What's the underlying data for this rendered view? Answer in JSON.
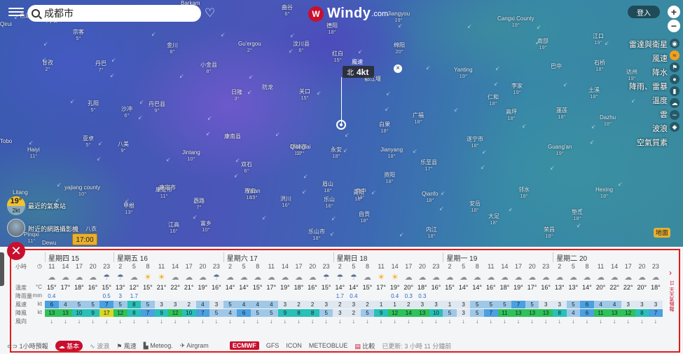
{
  "search": {
    "value": "成都市"
  },
  "logo": {
    "name": "Windy",
    "suffix": ".com"
  },
  "login_label": "登入",
  "zoom": {
    "in": "+",
    "out": "−"
  },
  "layers": [
    "雷達與衛星",
    "風速",
    "降水",
    "降雨、雷暴",
    "溫度",
    "雲",
    "波浪",
    "空氣質素"
  ],
  "active_layer": "風速",
  "wind_marker": {
    "caption": "風速",
    "direction": "北",
    "speed": "4kt"
  },
  "map_places": [
    {
      "n": "Barkam",
      "t": ""
    },
    {
      "n": "色达",
      "t": ""
    },
    {
      "n": "曲谷",
      "t": "6°"
    },
    {
      "n": "阿坝",
      "t": ""
    },
    {
      "n": "Jiangyou",
      "t": "19°"
    },
    {
      "n": "Cangxi County",
      "t": "19°"
    },
    {
      "n": "宗客",
      "t": "5°"
    },
    {
      "n": "金川",
      "t": "8°"
    },
    {
      "n": "Gu'ergou",
      "t": "2°"
    },
    {
      "n": "汶川县",
      "t": "6°"
    },
    {
      "n": "德阳",
      "t": "18°"
    },
    {
      "n": "绵阳",
      "t": "20°"
    },
    {
      "n": "南部",
      "t": "19°"
    },
    {
      "n": "江口",
      "t": "19°"
    },
    {
      "n": "达州",
      "t": "19°"
    },
    {
      "n": "甘孜",
      "t": "2°"
    },
    {
      "n": "丹巴",
      "t": "7°"
    },
    {
      "n": "小金县",
      "t": "8°"
    },
    {
      "n": "日隆",
      "t": "3°"
    },
    {
      "n": "防龙",
      "t": ""
    },
    {
      "n": "关口",
      "t": "15°"
    },
    {
      "n": "红白",
      "t": "15°"
    },
    {
      "n": "都江堰",
      "t": ""
    },
    {
      "n": "Yanting",
      "t": "19°"
    },
    {
      "n": "仁和",
      "t": "18°"
    },
    {
      "n": "李家",
      "t": "19°"
    },
    {
      "n": "土溪",
      "t": "18°"
    },
    {
      "n": "巴中",
      "t": ""
    },
    {
      "n": "石桥",
      "t": "18°"
    },
    {
      "n": "孔阳",
      "t": "5°"
    },
    {
      "n": "沙冲",
      "t": "6°"
    },
    {
      "n": "丹巴县",
      "t": "9°"
    },
    {
      "n": "康定市",
      "t": "11°"
    },
    {
      "n": "雅安",
      "t": "16°"
    },
    {
      "n": "邛崃市",
      "t": "18°"
    },
    {
      "n": "白果",
      "t": "18°"
    },
    {
      "n": "广福",
      "t": "18°"
    },
    {
      "n": "高坪",
      "t": "18°"
    },
    {
      "n": "蓬莲",
      "t": "18°"
    },
    {
      "n": "Dazhu",
      "t": "18°"
    },
    {
      "n": "八美",
      "t": "9°"
    },
    {
      "n": "亚卓",
      "t": "5°"
    },
    {
      "n": "Jintang",
      "t": "10°"
    },
    {
      "n": "Qionglai",
      "t": "17°"
    },
    {
      "n": "永安",
      "t": "18°"
    },
    {
      "n": "Jianyang",
      "t": "18°"
    },
    {
      "n": "乐至县",
      "t": "17°"
    },
    {
      "n": "遂宁市",
      "t": "18°"
    },
    {
      "n": "Guang'an",
      "t": "19°"
    },
    {
      "n": "Haiyi",
      "t": "11°"
    },
    {
      "n": "双石",
      "t": "6°"
    },
    {
      "n": "眉山",
      "t": "18°"
    },
    {
      "n": "资阳",
      "t": "18°"
    },
    {
      "n": "康南县",
      "t": ""
    },
    {
      "n": "yajiang county",
      "t": "10°"
    },
    {
      "n": "康定市",
      "t": ""
    },
    {
      "n": "Ya'an",
      "t": "13°"
    },
    {
      "n": "洪川",
      "t": "16°"
    },
    {
      "n": "资中",
      "t": "18°"
    },
    {
      "n": "Qianfo",
      "t": "18°"
    },
    {
      "n": "邻水",
      "t": "18°"
    },
    {
      "n": "Hexing",
      "t": "18°"
    },
    {
      "n": "甲根",
      "t": "13°"
    },
    {
      "n": "西路",
      "t": "7°"
    },
    {
      "n": "乐山",
      "t": "16°"
    },
    {
      "n": "青阳",
      "t": "18°"
    },
    {
      "n": "安岳",
      "t": "18°"
    },
    {
      "n": "内江",
      "t": "18°"
    },
    {
      "n": "荣昌",
      "t": "18°"
    },
    {
      "n": "富乡",
      "t": "10°"
    },
    {
      "n": "江高",
      "t": "16°"
    },
    {
      "n": "八衣",
      "t": "13°"
    },
    {
      "n": "乐山市",
      "t": "18°"
    },
    {
      "n": "自贡",
      "t": "18°"
    },
    {
      "n": "垫江",
      "t": "18°"
    },
    {
      "n": "大足",
      "t": "18°"
    },
    {
      "n": "Litang",
      "t": ""
    },
    {
      "n": "Dewu",
      "t": ""
    },
    {
      "n": "Qirui",
      "t": ""
    },
    {
      "n": "Pinqxi",
      "t": "11°"
    },
    {
      "n": "Tobo",
      "t": ""
    }
  ],
  "station": {
    "temp": "19°",
    "wind": "2kt",
    "label": "最近的氣象站"
  },
  "webcam": {
    "label": "附近的網路攝影機"
  },
  "time_pill": "17:00",
  "place_button": "地面",
  "forecast": {
    "days": [
      "星期四 15",
      "星期五 16",
      "星期六 17",
      "星期日 18",
      "星期一 19",
      "星期二 20"
    ],
    "row_labels": {
      "hours": "小時",
      "temp": "溫度",
      "temp_unit": "°C",
      "rain": "降雨量",
      "rain_unit": "mm",
      "wind": "風速",
      "wind_unit": "kt",
      "gust": "陣風",
      "gust_unit": "kt",
      "dir": "風向"
    },
    "hours": [
      "11",
      "14",
      "17",
      "20",
      "23",
      "2",
      "5",
      "8",
      "11",
      "14",
      "17",
      "20",
      "23",
      "2",
      "5",
      "8",
      "11",
      "14",
      "17",
      "20",
      "23",
      "2",
      "5",
      "8",
      "11",
      "14",
      "17",
      "20",
      "23",
      "2",
      "5",
      "8",
      "11",
      "14",
      "17",
      "20",
      "23",
      "2",
      "5",
      "8",
      "11",
      "14",
      "17",
      "20",
      "23"
    ],
    "icons": [
      "c",
      "c",
      "c",
      "c",
      "r",
      "r",
      "c",
      "s",
      "s",
      "c",
      "c",
      "c",
      "r",
      "c",
      "c",
      "c",
      "c",
      "c",
      "c",
      "c",
      "r",
      "r",
      "r",
      "c",
      "s",
      "s",
      "c",
      "c",
      "c",
      "c",
      "c",
      "c",
      "c",
      "c",
      "c",
      "c",
      "c",
      "c",
      "c",
      "c",
      "c",
      "c",
      "c",
      "c",
      "c"
    ],
    "temps": [
      "15°",
      "17°",
      "18°",
      "16°",
      "15°",
      "13°",
      "12°",
      "15°",
      "21°",
      "22°",
      "21°",
      "19°",
      "16°",
      "14°",
      "14°",
      "15°",
      "17°",
      "19°",
      "18°",
      "16°",
      "15°",
      "14°",
      "14°",
      "15°",
      "17°",
      "19°",
      "20°",
      "18°",
      "16°",
      "15°",
      "14°",
      "14°",
      "16°",
      "18°",
      "19°",
      "17°",
      "16°",
      "13°",
      "13°",
      "14°",
      "20°",
      "22°",
      "22°",
      "20°",
      "18°"
    ],
    "rain": [
      "0.4",
      "",
      "",
      "",
      "0.5",
      "3",
      "1.7",
      "",
      "",
      "",
      "",
      "",
      "",
      "",
      "",
      "",
      "",
      "",
      "",
      "",
      "",
      "1.7",
      "0.4",
      "",
      "",
      "0.4",
      "0.3",
      "0.3",
      "",
      "",
      "",
      "",
      "",
      "",
      "",
      "",
      "",
      "",
      "",
      "",
      "",
      "",
      "",
      "",
      ""
    ],
    "wind": [
      "6",
      "4",
      "5",
      "5",
      "7",
      "5",
      "8",
      "5",
      "3",
      "3",
      "2",
      "4",
      "3",
      "5",
      "4",
      "4",
      "4",
      "3",
      "2",
      "2",
      "3",
      "2",
      "3",
      "2",
      "1",
      "1",
      "2",
      "3",
      "3",
      "1",
      "3",
      "5",
      "5",
      "5",
      "7",
      "5",
      "3",
      "3",
      "5",
      "6",
      "4",
      "4",
      "3",
      "3",
      "3"
    ],
    "gust": [
      "13",
      "13",
      "10",
      "9",
      "17",
      "12",
      "8",
      "7",
      "9",
      "12",
      "10",
      "7",
      "5",
      "4",
      "6",
      "5",
      "5",
      "9",
      "8",
      "8",
      "5",
      "3",
      "2",
      "5",
      "9",
      "12",
      "14",
      "13",
      "10",
      "5",
      "3",
      "5",
      "7",
      "11",
      "13",
      "13",
      "13",
      "8",
      "4",
      "6",
      "11",
      "13",
      "12",
      "8",
      "7"
    ],
    "dirs": [
      "↓",
      "↓",
      "↓",
      "↓",
      "↓",
      "↓",
      "↓",
      "↓",
      "↓",
      "↓",
      "↓",
      "↓",
      "↓",
      "↓",
      "↓",
      "↓",
      "↓",
      "↓",
      "↓",
      "↓",
      "↓",
      "↓",
      "↓",
      "↓",
      "↓",
      "↓",
      "↓",
      "↓",
      "↓",
      "↓",
      "↓",
      "↓",
      "↓",
      "↓",
      "↓",
      "↓",
      "↓",
      "↓",
      "↓",
      "↓",
      "↓",
      "↓",
      "↓",
      "↓",
      "↓"
    ],
    "side_label": "11 天天氣預報"
  },
  "footer": {
    "hourly": "1小時預報",
    "tabs": [
      "基本",
      "波浪",
      "風速",
      "Meteog.",
      "Airgram"
    ],
    "models": [
      "ECMWF",
      "GFS",
      "ICON",
      "METEOBLUE",
      "比較"
    ],
    "updated": "已更新: 3 小時 11 分鐘前"
  },
  "colors": {
    "accent": "#c8102e",
    "highlight": "#e21b1b"
  }
}
